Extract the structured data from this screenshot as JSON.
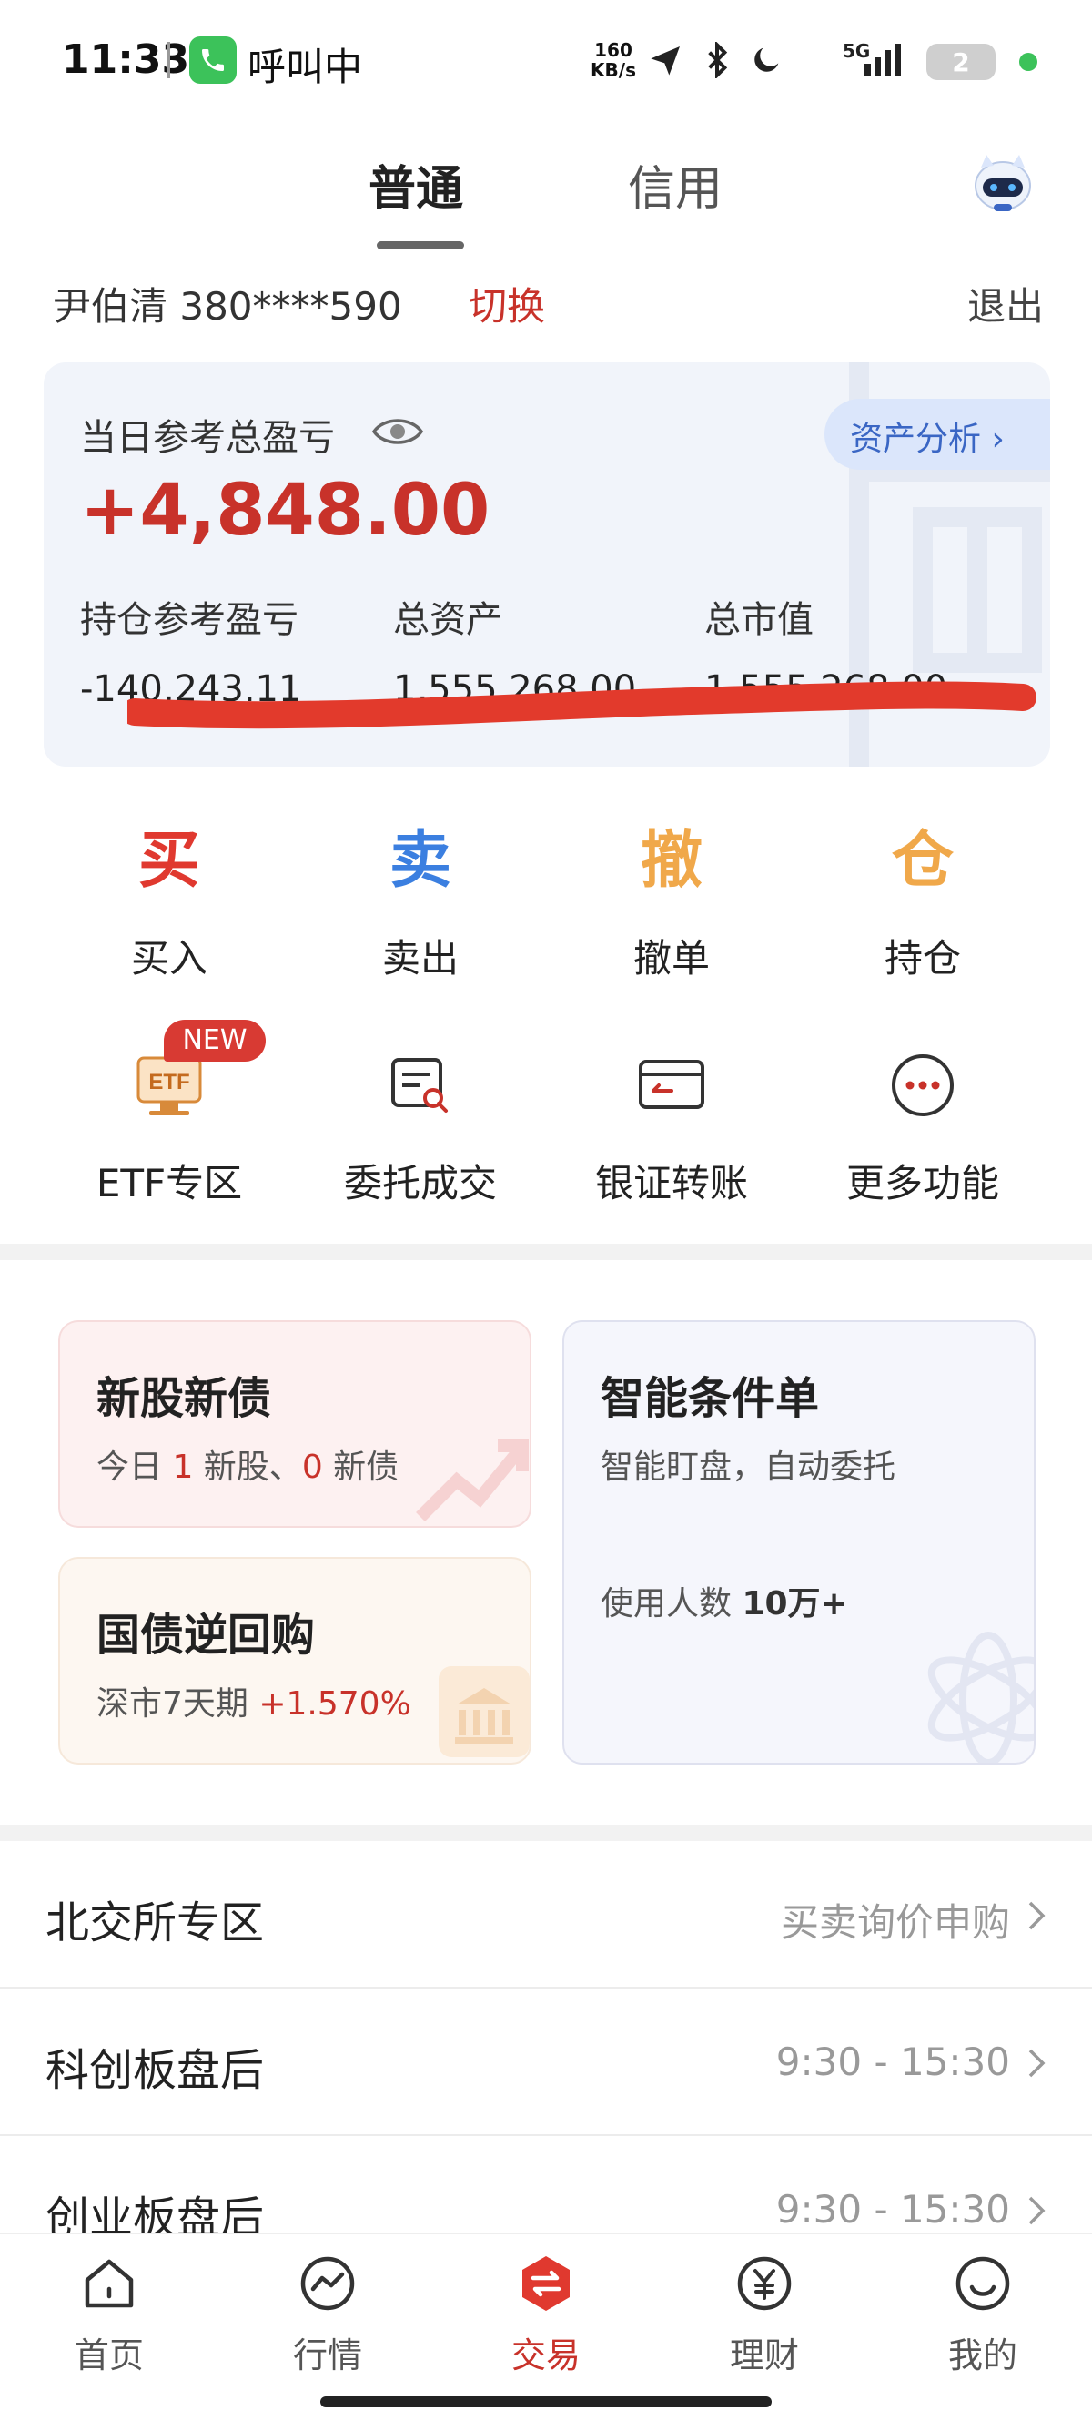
{
  "status_bar": {
    "time": "11:33",
    "call_text": "呼叫中",
    "net_speed_value": "160",
    "net_speed_unit": "KB/s",
    "network": "5G",
    "battery": "2",
    "icons": [
      "phone-icon",
      "send-icon",
      "bluetooth-icon",
      "moon-icon",
      "signal-icon",
      "battery-icon"
    ]
  },
  "tabs": [
    {
      "label": "普通",
      "active": true
    },
    {
      "label": "信用",
      "active": false
    }
  ],
  "account": {
    "name_and_id": "尹伯清  380****590",
    "switch_label": "切换",
    "logout_label": "退出"
  },
  "asset_card": {
    "pl_label": "当日参考总盈亏",
    "pl_value": "+4,848.00",
    "analysis_label": "资产分析 ›",
    "stats": [
      {
        "label": "持仓参考盈亏",
        "value": "-140,243.11"
      },
      {
        "label": "总资产",
        "value": "1,555,268.00"
      },
      {
        "label": "总市值",
        "value": "1,555,268.00"
      }
    ]
  },
  "trade_functions": [
    {
      "glyph": "买",
      "label": "买入",
      "color": "#e0392f"
    },
    {
      "glyph": "卖",
      "label": "卖出",
      "color": "#3b7fe0"
    },
    {
      "glyph": "撤",
      "label": "撤单",
      "color": "#f0a84a"
    },
    {
      "glyph": "仓",
      "label": "持仓",
      "color": "#f0a84a"
    }
  ],
  "more_functions": [
    {
      "label": "ETF专区",
      "icon": "etf-icon",
      "badge": "NEW"
    },
    {
      "label": "委托成交",
      "icon": "order-search-icon"
    },
    {
      "label": "银证转账",
      "icon": "bank-card-icon"
    },
    {
      "label": "更多功能",
      "icon": "more-icon"
    }
  ],
  "promo": {
    "ipo": {
      "title": "新股新债",
      "prefix": "今日 ",
      "stock_count": "1",
      "middle": " 新股、",
      "bond_count": "0",
      "suffix": " 新债"
    },
    "repo": {
      "title": "国债逆回购",
      "desc": "深市7天期 ",
      "rate": "+1.570%"
    },
    "smart": {
      "title": "智能条件单",
      "desc": "智能盯盘，自动委托",
      "users_label": "使用人数 ",
      "users_value": "10万+"
    }
  },
  "list_rows": [
    {
      "title": "北交所专区",
      "right": "买卖询价申购"
    },
    {
      "title": "科创板盘后",
      "right": "9:30 - 15:30"
    },
    {
      "title": "创业板盘后",
      "right": "9:30 - 15:30"
    }
  ],
  "bottom_nav": [
    {
      "label": "首页",
      "icon": "home-icon",
      "active": false
    },
    {
      "label": "行情",
      "icon": "market-icon",
      "active": false
    },
    {
      "label": "交易",
      "icon": "trade-icon",
      "active": true
    },
    {
      "label": "理财",
      "icon": "wealth-icon",
      "active": false
    },
    {
      "label": "我的",
      "icon": "profile-icon",
      "active": false
    }
  ],
  "colors": {
    "accent_red": "#c8322a",
    "link_blue": "#3a66c4"
  }
}
